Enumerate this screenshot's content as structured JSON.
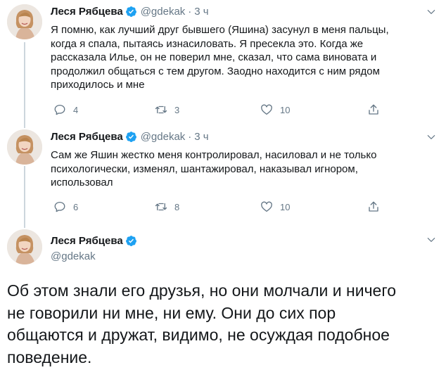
{
  "tweets": [
    {
      "author_name": "Леся Рябцева",
      "handle": "@gdekak",
      "time": "3 ч",
      "text": "Я помню, как лучший друг бывшего (Яшина) засунул в меня пальцы,\nкогда я спала, пытаясь изнасиловать. Я пресекла это. Когда же\nрассказала Илье, он не поверил мне, сказал, что сама виновата и\nпродолжил общаться с тем другом. Заодно находится с ним рядом\nприходилось и мне",
      "replies": "4",
      "retweets": "3",
      "likes": "10"
    },
    {
      "author_name": "Леся Рябцева",
      "handle": "@gdekak",
      "time": "3 ч",
      "text": "Сам же Яшин жестко меня контролировал, насиловал и не только\nпсихологически, изменял, шантажировал, наказывал игнором,\nиспользовал",
      "replies": "6",
      "retweets": "8",
      "likes": "10"
    }
  ],
  "main_tweet": {
    "author_name": "Леся Рябцева",
    "handle": "@gdekak",
    "text": "Об этом знали его друзья, но они молчали и ничего\nне говорили ни мне, ни ему. Они до сих пор\nобщаются и дружат, видимо, не осуждая подобное\nповедение."
  },
  "separator": "·",
  "colors": {
    "text": "#14171a",
    "secondary": "#657786",
    "verified": "#1da1f2",
    "thread_line": "#ccd6dd"
  },
  "icons": [
    "verified-badge-icon",
    "chevron-down-icon",
    "reply-icon",
    "retweet-icon",
    "like-icon",
    "share-icon"
  ]
}
